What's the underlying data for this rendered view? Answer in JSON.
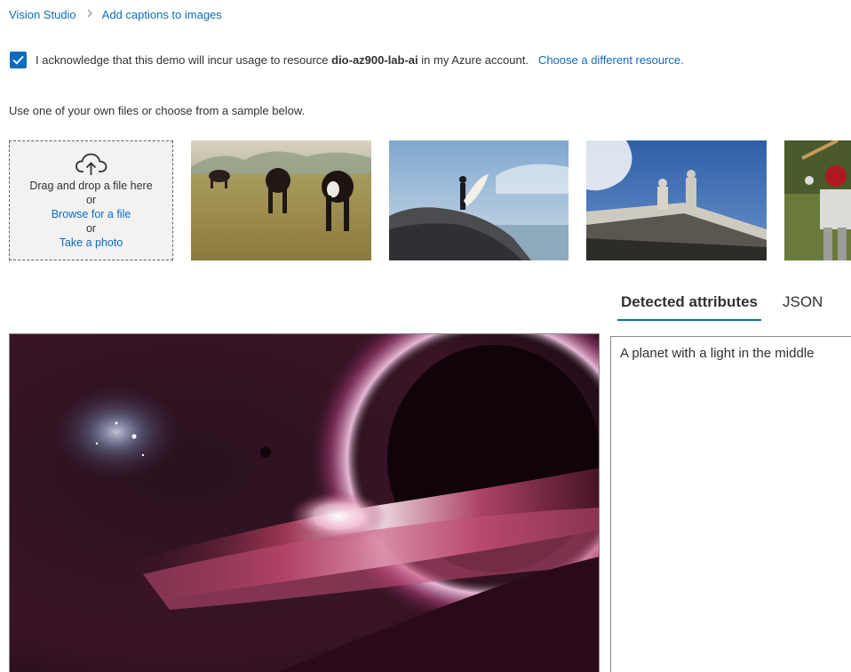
{
  "breadcrumb": {
    "root": "Vision Studio",
    "separator": ">",
    "current": "Add captions to images"
  },
  "acknowledge": {
    "checked": true,
    "text_before": "I acknowledge that this demo will incur usage to resource ",
    "resource": "dio-az900-lab-ai",
    "text_after": " in my Azure account.",
    "link": "Choose a different resource."
  },
  "instructions": "Use one of your own files or choose from a sample below.",
  "upload": {
    "icon": "cloud-upload-icon",
    "drag_text": "Drag and drop a file here",
    "or_1": "or",
    "browse_link": "Browse for a file",
    "or_2": "or",
    "photo_link": "Take a photo"
  },
  "samples": [
    {
      "name": "sample-cows"
    },
    {
      "name": "sample-surfer"
    },
    {
      "name": "sample-building-statues"
    },
    {
      "name": "sample-baseball-player"
    }
  ],
  "tabs": [
    {
      "label": "Detected attributes",
      "active": true
    },
    {
      "label": "JSON",
      "active": false
    }
  ],
  "result": {
    "caption": "A planet with a light in the middle"
  },
  "colors": {
    "accent": "#0f6cbd",
    "text": "#323130"
  }
}
